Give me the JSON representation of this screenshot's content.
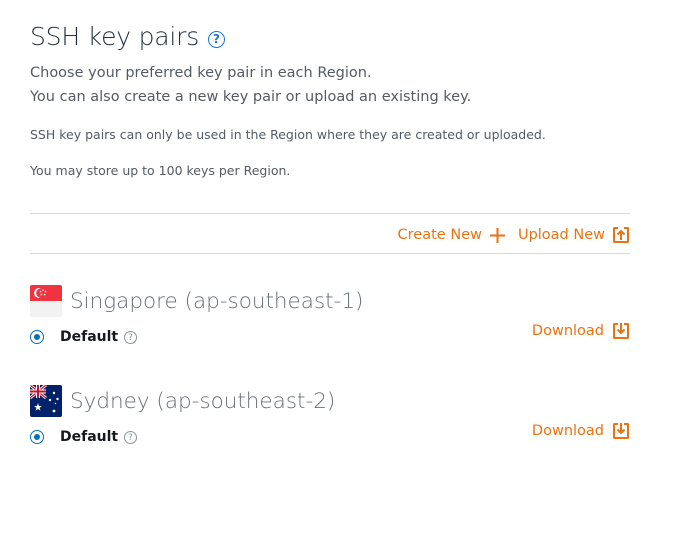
{
  "header": {
    "title": "SSH key pairs",
    "help_glyph": "?"
  },
  "description": {
    "line1": "Choose your preferred key pair in each Region.",
    "line2": "You can also create a new key pair or upload an existing key.",
    "note1": "SSH key pairs can only be used in the Region where they are created or uploaded.",
    "note2": "You may store up to 100 keys per Region."
  },
  "actions": {
    "create_label": "Create New",
    "create_icon": "plus-icon",
    "upload_label": "Upload New",
    "upload_icon": "upload-icon"
  },
  "regions": [
    {
      "name": "Singapore (ap-southeast-1)",
      "flag": "singapore-flag-icon",
      "key_label": "Default",
      "selected": true,
      "download_label": "Download",
      "help_glyph": "?"
    },
    {
      "name": "Sydney (ap-southeast-2)",
      "flag": "australia-flag-icon",
      "key_label": "Default",
      "selected": true,
      "download_label": "Download",
      "help_glyph": "?"
    }
  ],
  "colors": {
    "accent_orange": "#ec7211",
    "radio_blue": "#0073bb",
    "help_blue": "#1a73e8",
    "text_dark": "#232f3e",
    "text_muted": "#545b64"
  }
}
